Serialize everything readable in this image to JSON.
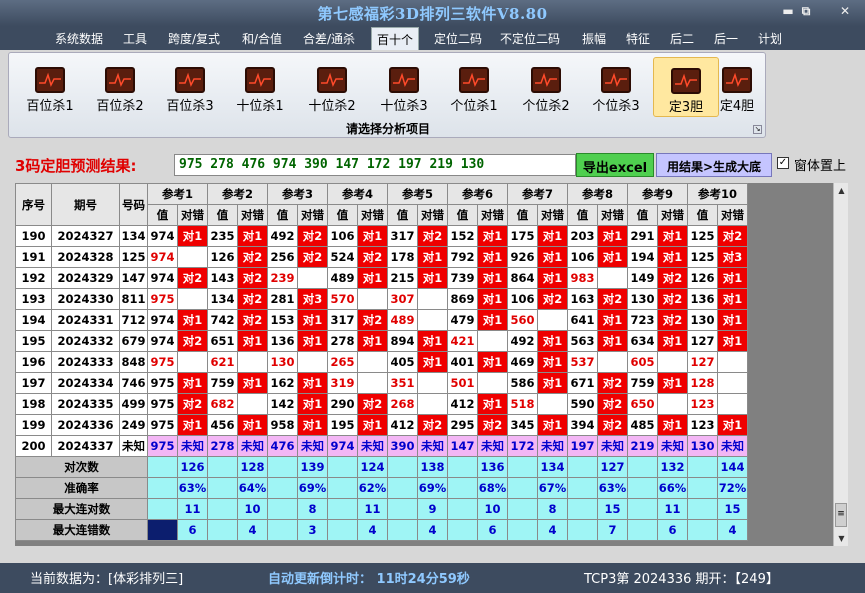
{
  "window": {
    "title": "第七感福彩3D排列三软件V8.80",
    "min": "▬",
    "max": "⧉",
    "close": "✕"
  },
  "menu": [
    "系统数据",
    "工具",
    "跨度/复式",
    "和/合值",
    "合差/通杀",
    "百十个",
    "定位二码",
    "不定位二码",
    "振幅",
    "特征",
    "后二",
    "后一",
    "计划"
  ],
  "active_menu": "百十个",
  "ribbon": {
    "items": [
      "百位杀1",
      "百位杀2",
      "百位杀3",
      "十位杀1",
      "十位杀2",
      "十位杀3",
      "个位杀1",
      "个位杀2",
      "个位杀3",
      "定3胆",
      "定4胆"
    ],
    "selected": "定3胆",
    "caption": "请选择分析项目"
  },
  "prediction": {
    "label": "3码定胆预测结果:",
    "value": "975 278 476 974 390 147 172 197 219 130"
  },
  "buttons": {
    "excel": "导出excel",
    "generate": "用结果>生成大底"
  },
  "checkbox": {
    "label": "窗体置上",
    "checked": true,
    "mark": "✓"
  },
  "table": {
    "col_headers": {
      "seq": "序号",
      "issue": "期号",
      "number": "号码"
    },
    "groups": [
      "参考1",
      "参考2",
      "参考3",
      "参考4",
      "参考5",
      "参考6",
      "参考7",
      "参考8",
      "参考9",
      "参考10"
    ],
    "subheaders": [
      "值",
      "对错"
    ],
    "rows": [
      {
        "seq": "190",
        "issue": "2024327",
        "num": "134",
        "cells": [
          [
            "974",
            "对1"
          ],
          [
            "235",
            "对1"
          ],
          [
            "492",
            "对2"
          ],
          [
            "106",
            "对1"
          ],
          [
            "317",
            "对2"
          ],
          [
            "152",
            "对1"
          ],
          [
            "175",
            "对1"
          ],
          [
            "203",
            "对1"
          ],
          [
            "291",
            "对1"
          ],
          [
            "125",
            "对2"
          ]
        ]
      },
      {
        "seq": "191",
        "issue": "2024328",
        "num": "125",
        "cells": [
          [
            "974",
            ""
          ],
          [
            "126",
            "对2"
          ],
          [
            "256",
            "对2"
          ],
          [
            "524",
            "对2"
          ],
          [
            "178",
            "对1"
          ],
          [
            "792",
            "对1"
          ],
          [
            "926",
            "对1"
          ],
          [
            "106",
            "对1"
          ],
          [
            "194",
            "对1"
          ],
          [
            "125",
            "对3"
          ]
        ]
      },
      {
        "seq": "192",
        "issue": "2024329",
        "num": "147",
        "cells": [
          [
            "974",
            "对2"
          ],
          [
            "143",
            "对2"
          ],
          [
            "239",
            ""
          ],
          [
            "489",
            "对1"
          ],
          [
            "215",
            "对1"
          ],
          [
            "739",
            "对1"
          ],
          [
            "864",
            "对1"
          ],
          [
            "983",
            ""
          ],
          [
            "149",
            "对2"
          ],
          [
            "126",
            "对1"
          ]
        ]
      },
      {
        "seq": "193",
        "issue": "2024330",
        "num": "811",
        "cells": [
          [
            "975",
            ""
          ],
          [
            "134",
            "对2"
          ],
          [
            "281",
            "对3"
          ],
          [
            "570",
            ""
          ],
          [
            "307",
            ""
          ],
          [
            "869",
            "对1"
          ],
          [
            "106",
            "对2"
          ],
          [
            "163",
            "对2"
          ],
          [
            "130",
            "对2"
          ],
          [
            "136",
            "对1"
          ]
        ]
      },
      {
        "seq": "194",
        "issue": "2024331",
        "num": "712",
        "cells": [
          [
            "974",
            "对1"
          ],
          [
            "742",
            "对2"
          ],
          [
            "153",
            "对1"
          ],
          [
            "317",
            "对2"
          ],
          [
            "489",
            ""
          ],
          [
            "479",
            "对1"
          ],
          [
            "560",
            ""
          ],
          [
            "641",
            "对1"
          ],
          [
            "723",
            "对2"
          ],
          [
            "130",
            "对1"
          ]
        ]
      },
      {
        "seq": "195",
        "issue": "2024332",
        "num": "679",
        "cells": [
          [
            "974",
            "对2"
          ],
          [
            "651",
            "对1"
          ],
          [
            "136",
            "对1"
          ],
          [
            "278",
            "对1"
          ],
          [
            "894",
            "对1"
          ],
          [
            "421",
            ""
          ],
          [
            "492",
            "对1"
          ],
          [
            "563",
            "对1"
          ],
          [
            "634",
            "对1"
          ],
          [
            "127",
            "对1"
          ]
        ]
      },
      {
        "seq": "196",
        "issue": "2024333",
        "num": "848",
        "cells": [
          [
            "975",
            ""
          ],
          [
            "621",
            ""
          ],
          [
            "130",
            ""
          ],
          [
            "265",
            ""
          ],
          [
            "405",
            "对1"
          ],
          [
            "401",
            "对1"
          ],
          [
            "469",
            "对1"
          ],
          [
            "537",
            ""
          ],
          [
            "605",
            ""
          ],
          [
            "127",
            ""
          ]
        ]
      },
      {
        "seq": "197",
        "issue": "2024334",
        "num": "746",
        "cells": [
          [
            "975",
            "对1"
          ],
          [
            "759",
            "对1"
          ],
          [
            "162",
            "对1"
          ],
          [
            "319",
            ""
          ],
          [
            "351",
            ""
          ],
          [
            "501",
            ""
          ],
          [
            "586",
            "对1"
          ],
          [
            "671",
            "对2"
          ],
          [
            "759",
            "对1"
          ],
          [
            "128",
            ""
          ]
        ]
      },
      {
        "seq": "198",
        "issue": "2024335",
        "num": "499",
        "cells": [
          [
            "975",
            "对2"
          ],
          [
            "682",
            ""
          ],
          [
            "142",
            "对1"
          ],
          [
            "290",
            "对2"
          ],
          [
            "268",
            ""
          ],
          [
            "412",
            "对1"
          ],
          [
            "518",
            ""
          ],
          [
            "590",
            "对2"
          ],
          [
            "650",
            ""
          ],
          [
            "123",
            ""
          ]
        ]
      },
      {
        "seq": "199",
        "issue": "2024336",
        "num": "249",
        "cells": [
          [
            "975",
            "对1"
          ],
          [
            "456",
            "对1"
          ],
          [
            "958",
            "对1"
          ],
          [
            "195",
            "对1"
          ],
          [
            "412",
            "对2"
          ],
          [
            "295",
            "对2"
          ],
          [
            "345",
            "对1"
          ],
          [
            "394",
            "对2"
          ],
          [
            "485",
            "对1"
          ],
          [
            "123",
            "对1"
          ]
        ]
      }
    ],
    "red_value_rows": [
      [
        false,
        false,
        false,
        false,
        false,
        false,
        false,
        false,
        false,
        false
      ],
      [
        true,
        false,
        false,
        false,
        false,
        false,
        false,
        false,
        false,
        false
      ],
      [
        false,
        false,
        true,
        false,
        false,
        false,
        false,
        true,
        false,
        false
      ],
      [
        true,
        false,
        false,
        true,
        true,
        false,
        false,
        false,
        false,
        false
      ],
      [
        false,
        false,
        false,
        false,
        true,
        false,
        true,
        false,
        false,
        false
      ],
      [
        false,
        false,
        false,
        false,
        false,
        true,
        false,
        false,
        false,
        false
      ],
      [
        true,
        true,
        true,
        true,
        false,
        false,
        false,
        true,
        true,
        true
      ],
      [
        false,
        false,
        false,
        true,
        true,
        true,
        false,
        false,
        false,
        true
      ],
      [
        false,
        true,
        false,
        false,
        true,
        false,
        true,
        false,
        true,
        true
      ],
      [
        false,
        false,
        false,
        false,
        false,
        false,
        false,
        false,
        false,
        false
      ]
    ],
    "pred_row": {
      "seq": "200",
      "issue": "2024337",
      "num": "未知",
      "values": [
        "975",
        "278",
        "476",
        "974",
        "390",
        "147",
        "172",
        "197",
        "219",
        "130"
      ],
      "status": "未知"
    },
    "stats": [
      {
        "label": "对次数",
        "values": [
          "126",
          "128",
          "139",
          "124",
          "138",
          "136",
          "134",
          "127",
          "132",
          "144"
        ]
      },
      {
        "label": "准确率",
        "values": [
          "63%",
          "64%",
          "69%",
          "62%",
          "69%",
          "68%",
          "67%",
          "63%",
          "66%",
          "72%"
        ]
      },
      {
        "label": "最大连对数",
        "values": [
          "11",
          "10",
          "8",
          "11",
          "9",
          "10",
          "8",
          "15",
          "11",
          "15"
        ]
      },
      {
        "label": "最大连错数",
        "values": [
          "6",
          "4",
          "3",
          "4",
          "4",
          "6",
          "4",
          "7",
          "6",
          "4"
        ]
      }
    ]
  },
  "status": {
    "source": "当前数据为：[体彩排列三]",
    "countdown": "自动更新倒计时： 11时24分59秒",
    "period": "TCP3第 2024336 期开：【249】"
  },
  "colors": {
    "hit": "#ef0000",
    "pred": "#f3b6f5",
    "stat": "#9ff5f5",
    "accent": "#3d4b5f"
  }
}
